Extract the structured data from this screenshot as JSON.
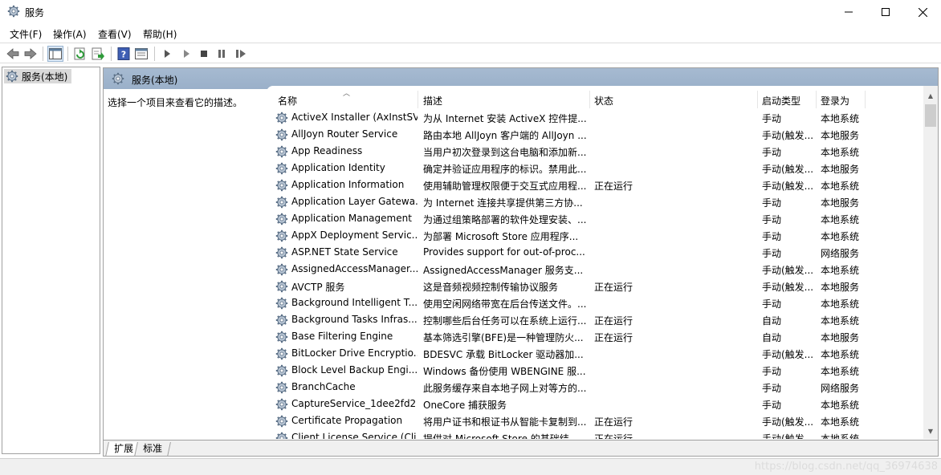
{
  "window": {
    "title": "服务"
  },
  "menu": [
    "文件(F)",
    "操作(A)",
    "查看(V)",
    "帮助(H)"
  ],
  "tree": {
    "node_label": "服务(本地)"
  },
  "content": {
    "title": "服务(本地)",
    "description_prompt": "选择一个项目来查看它的描述。"
  },
  "columns": {
    "name": "名称",
    "desc": "描述",
    "status": "状态",
    "startup": "启动类型",
    "logon": "登录为"
  },
  "services": [
    {
      "name": "ActiveX Installer (AxInstSV)",
      "desc": "为从 Internet 安装 ActiveX 控件提...",
      "status": "",
      "startup": "手动",
      "logon": "本地系统"
    },
    {
      "name": "AllJoyn Router Service",
      "desc": "路由本地 AllJoyn 客户端的 AllJoyn ...",
      "status": "",
      "startup": "手动(触发...",
      "logon": "本地服务"
    },
    {
      "name": "App Readiness",
      "desc": "当用户初次登录到这台电脑和添加新...",
      "status": "",
      "startup": "手动",
      "logon": "本地系统"
    },
    {
      "name": "Application Identity",
      "desc": "确定并验证应用程序的标识。禁用此...",
      "status": "",
      "startup": "手动(触发...",
      "logon": "本地服务"
    },
    {
      "name": "Application Information",
      "desc": "使用辅助管理权限便于交互式应用程...",
      "status": "正在运行",
      "startup": "手动(触发...",
      "logon": "本地系统"
    },
    {
      "name": "Application Layer Gatewa...",
      "desc": "为 Internet 连接共享提供第三方协...",
      "status": "",
      "startup": "手动",
      "logon": "本地服务"
    },
    {
      "name": "Application Management",
      "desc": "为通过组策略部署的软件处理安装、...",
      "status": "",
      "startup": "手动",
      "logon": "本地系统"
    },
    {
      "name": "AppX Deployment Servic...",
      "desc": "为部署 Microsoft Store 应用程序...",
      "status": "",
      "startup": "手动",
      "logon": "本地系统"
    },
    {
      "name": "ASP.NET State Service",
      "desc": "Provides support for out-of-proc...",
      "status": "",
      "startup": "手动",
      "logon": "网络服务"
    },
    {
      "name": "AssignedAccessManager...",
      "desc": "AssignedAccessManager 服务支...",
      "status": "",
      "startup": "手动(触发...",
      "logon": "本地系统"
    },
    {
      "name": "AVCTP 服务",
      "desc": "这是音频视频控制传输协议服务",
      "status": "正在运行",
      "startup": "手动(触发...",
      "logon": "本地服务"
    },
    {
      "name": "Background Intelligent T...",
      "desc": "使用空闲网络带宽在后台传送文件。...",
      "status": "",
      "startup": "手动",
      "logon": "本地系统"
    },
    {
      "name": "Background Tasks Infras...",
      "desc": "控制哪些后台任务可以在系统上运行...",
      "status": "正在运行",
      "startup": "自动",
      "logon": "本地系统"
    },
    {
      "name": "Base Filtering Engine",
      "desc": "基本筛选引擎(BFE)是一种管理防火...",
      "status": "正在运行",
      "startup": "自动",
      "logon": "本地服务"
    },
    {
      "name": "BitLocker Drive Encryptio...",
      "desc": "BDESVC 承载 BitLocker 驱动器加...",
      "status": "",
      "startup": "手动(触发...",
      "logon": "本地系统"
    },
    {
      "name": "Block Level Backup Engi...",
      "desc": "Windows 备份使用 WBENGINE 服...",
      "status": "",
      "startup": "手动",
      "logon": "本地系统"
    },
    {
      "name": "BranchCache",
      "desc": "此服务缓存来自本地子网上对等方的...",
      "status": "",
      "startup": "手动",
      "logon": "网络服务"
    },
    {
      "name": "CaptureService_1dee2fd2",
      "desc": "OneCore 捕获服务",
      "status": "",
      "startup": "手动",
      "logon": "本地系统"
    },
    {
      "name": "Certificate Propagation",
      "desc": "将用户证书和根证书从智能卡复制到...",
      "status": "正在运行",
      "startup": "手动(触发...",
      "logon": "本地系统"
    },
    {
      "name": "Client License Service (Cli...",
      "desc": "提供对 Microsoft Store 的基础结...",
      "status": "正在运行",
      "startup": "手动(触发...",
      "logon": "本地系统"
    }
  ],
  "tabs": [
    "扩展",
    "标准"
  ],
  "watermark": "https://blog.csdn.net/qq_36974638"
}
